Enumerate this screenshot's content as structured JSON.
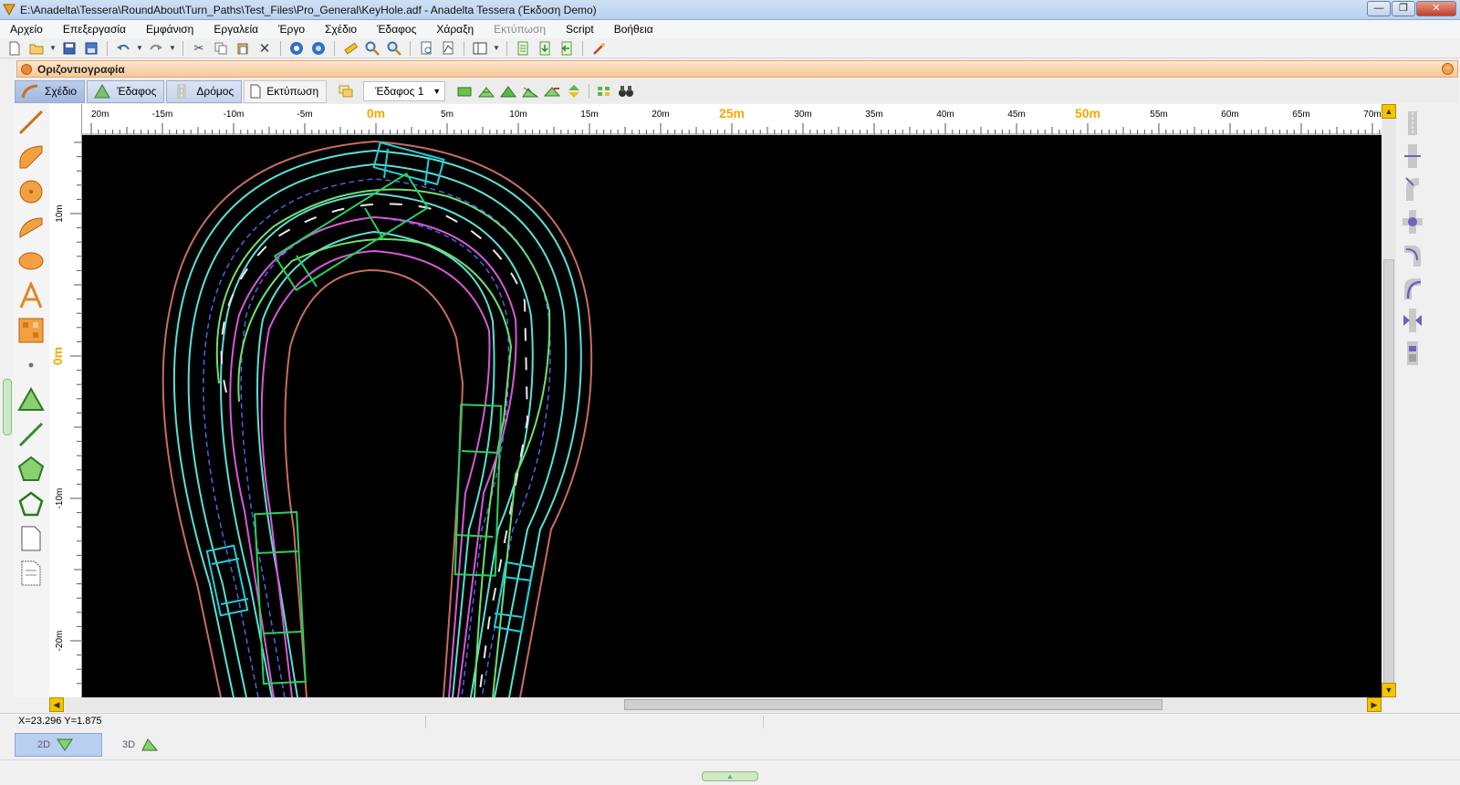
{
  "window": {
    "title": "E:\\Anadelta\\Tessera\\RoundAbout\\Turn_Paths\\Test_Files\\Pro_General\\KeyHole.adf - Anadelta Tessera (Έκδοση Demo)",
    "minimize": "—",
    "maximize": "❐",
    "close": "✕"
  },
  "menu": [
    {
      "label": "Αρχείο",
      "enabled": true
    },
    {
      "label": "Επεξεργασία",
      "enabled": true
    },
    {
      "label": "Εμφάνιση",
      "enabled": true
    },
    {
      "label": "Εργαλεία",
      "enabled": true
    },
    {
      "label": "Έργο",
      "enabled": true
    },
    {
      "label": "Σχέδιο",
      "enabled": true
    },
    {
      "label": "Έδαφος",
      "enabled": true
    },
    {
      "label": "Χάραξη",
      "enabled": true
    },
    {
      "label": "Εκτύπωση",
      "enabled": false
    },
    {
      "label": "Script",
      "enabled": true
    },
    {
      "label": "Βοήθεια",
      "enabled": true
    }
  ],
  "toolbar_icons": [
    "new-file-icon",
    "open-folder-icon",
    "save-icon",
    "save-all-icon",
    "undo-icon",
    "redo-icon",
    "cut-icon",
    "copy-icon",
    "paste-icon",
    "delete-icon",
    "zoom-in-icon",
    "zoom-out-icon",
    "measure-icon",
    "zoom-window-icon",
    "zoom-extents-icon",
    "print-preview-icon",
    "plot-icon",
    "layout-icon",
    "list-icon",
    "import-icon",
    "export-icon",
    "wizard-icon"
  ],
  "panel": {
    "title": "Οριζοντιογραφία",
    "collapse": "−"
  },
  "mode_tabs": {
    "drawing": "Σχέδιο",
    "ground": "Έδαφος",
    "road": "Δρόμος",
    "print": "Εκτύπωση"
  },
  "ground_select": {
    "value": "Έδαφος 1"
  },
  "ruler_h": {
    "labels": [
      "20m",
      "-15m",
      "-10m",
      "-5m",
      "0m",
      "5m",
      "10m",
      "15m",
      "20m",
      "25m",
      "30m",
      "35m",
      "40m",
      "45m",
      "50m",
      "55m",
      "60m",
      "65m",
      "70m"
    ],
    "highlight": [
      "0m",
      "25m",
      "50m"
    ]
  },
  "ruler_v": {
    "labels": [
      "10m",
      "0m",
      "-10m",
      "-20m"
    ]
  },
  "status": {
    "coords": "X=23.296  Y=1.875"
  },
  "view_tabs": {
    "tab_2d": "2D",
    "tab_3d": "3D"
  },
  "colors": {
    "canvas_bg": "#000000",
    "outer_edge": "#c86e5e",
    "cyan_line": "#5be0d4",
    "dashed_line": "#5560e0",
    "green_path": "#6fe06f",
    "magenta_path": "#d65ad6",
    "vehicle_green": "#28d060",
    "vehicle_cyan": "#20d0d8",
    "ruler_highlight": "#f5a800"
  }
}
